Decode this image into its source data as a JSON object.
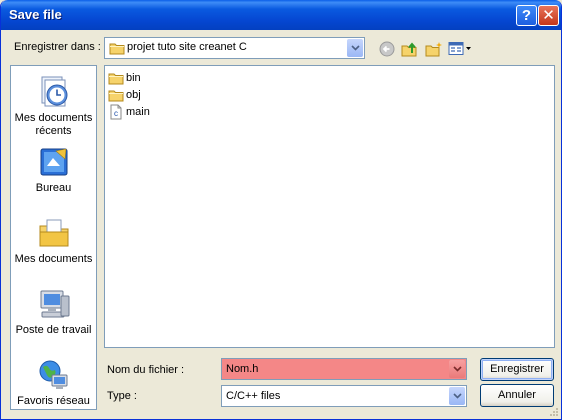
{
  "window": {
    "title": "Save file"
  },
  "titlebar": {
    "help_symbol": "?",
    "close_symbol": "✕"
  },
  "lookin": {
    "label": "Enregistrer dans :",
    "value": "projet tuto site creanet C"
  },
  "toolbar": {
    "icons": [
      "back-icon",
      "up-folder-icon",
      "new-folder-icon",
      "view-menu-icon"
    ]
  },
  "places": [
    {
      "label": "Mes documents récents",
      "icon": "recent-documents-icon"
    },
    {
      "label": "Bureau",
      "icon": "desktop-icon"
    },
    {
      "label": "Mes documents",
      "icon": "my-documents-icon"
    },
    {
      "label": "Poste de travail",
      "icon": "my-computer-icon"
    },
    {
      "label": "Favoris réseau",
      "icon": "network-places-icon"
    }
  ],
  "files": [
    {
      "name": "bin",
      "type": "folder"
    },
    {
      "name": "obj",
      "type": "folder"
    },
    {
      "name": "main",
      "type": "c-file",
      "badge": "c"
    }
  ],
  "filename": {
    "label": "Nom du fichier :",
    "value": "Nom.h",
    "highlight_color": "#f48787"
  },
  "filetype": {
    "label": "Type :",
    "value": "C/C++ files"
  },
  "buttons": {
    "save": "Enregistrer",
    "cancel": "Annuler"
  },
  "colors": {
    "title_bar": "#0a5ae0",
    "dialog_bg": "#ece9d8",
    "border": "#7f9db9"
  }
}
